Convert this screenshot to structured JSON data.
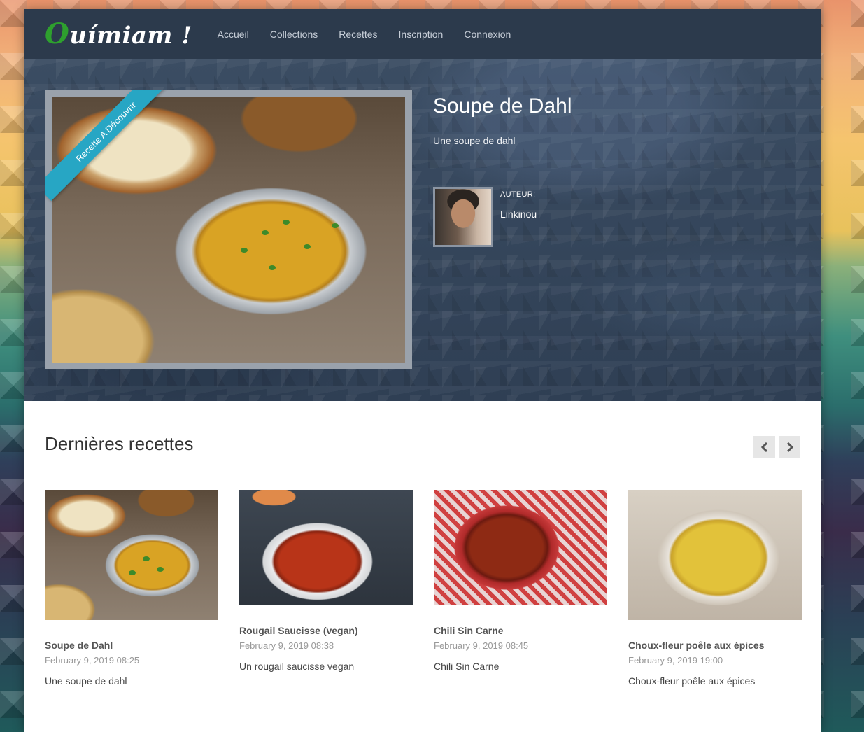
{
  "header": {
    "logo_first": "O",
    "logo_rest": "uímiam !",
    "nav": [
      "Accueil",
      "Collections",
      "Recettes",
      "Inscription",
      "Connexion"
    ]
  },
  "hero": {
    "ribbon": "Recette A Découvrir",
    "title": "Soupe de Dahl",
    "description": "Une soupe de dahl",
    "author_label": "AUTEUR:",
    "author_name": "Linkinou"
  },
  "latest": {
    "title": "Dernières recettes",
    "prev_icon": "chevron-left-icon",
    "next_icon": "chevron-right-icon",
    "cards": [
      {
        "title": "Soupe de Dahl",
        "date": "February 9, 2019 08:25",
        "description": "Une soupe de dahl"
      },
      {
        "title": "Rougail Saucisse (vegan)",
        "date": "February 9, 2019 08:38",
        "description": "Un rougail saucisse vegan"
      },
      {
        "title": "Chili Sin Carne",
        "date": "February 9, 2019 08:45",
        "description": "Chili Sin Carne"
      },
      {
        "title": "Choux-fleur poêle aux épices",
        "date": "February 9, 2019 19:00",
        "description": "Choux-fleur poêle aux épices"
      }
    ]
  },
  "colors": {
    "navbar": "#2c3a4c",
    "ribbon": "#27a6c4",
    "logo_accent": "#2ea02e"
  }
}
